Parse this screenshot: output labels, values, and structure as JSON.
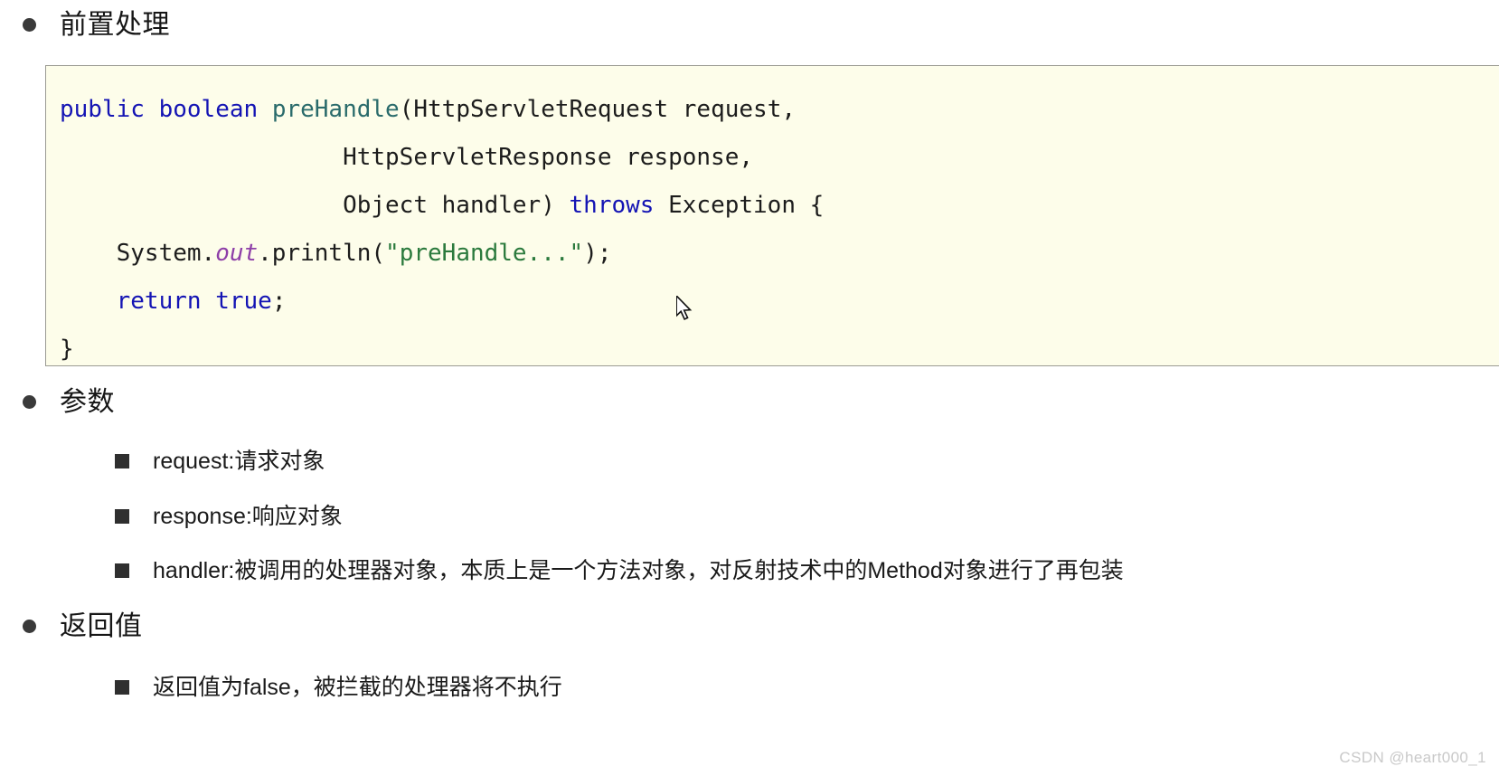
{
  "sections": [
    {
      "bullet": "disc",
      "label": "前置处理"
    },
    {
      "bullet": "disc",
      "label": "参数"
    },
    {
      "bullet": "disc",
      "label": "返回值"
    }
  ],
  "headings": {
    "pre_handle": "前置处理",
    "parameters": "参数",
    "return_value": "返回值"
  },
  "code": {
    "language": "java",
    "lines": [
      {
        "tokens": [
          {
            "text": "public",
            "style": "keyword"
          },
          {
            "text": " ",
            "style": "plain"
          },
          {
            "text": "boolean",
            "style": "keyword"
          },
          {
            "text": " ",
            "style": "plain"
          },
          {
            "text": "preHandle",
            "style": "function"
          },
          {
            "text": "(HttpServletRequest request,",
            "style": "plain"
          }
        ]
      },
      {
        "tokens": [
          {
            "text": "                    HttpServletResponse response,",
            "style": "plain"
          }
        ]
      },
      {
        "tokens": [
          {
            "text": "                    Object handler) ",
            "style": "plain"
          },
          {
            "text": "throws",
            "style": "keyword"
          },
          {
            "text": " Exception {",
            "style": "plain"
          }
        ]
      },
      {
        "tokens": [
          {
            "text": "    System.",
            "style": "plain"
          },
          {
            "text": "out",
            "style": "field"
          },
          {
            "text": ".println(",
            "style": "plain"
          },
          {
            "text": "\"preHandle...\"",
            "style": "string"
          },
          {
            "text": ");",
            "style": "plain"
          }
        ]
      },
      {
        "tokens": [
          {
            "text": "    ",
            "style": "plain"
          },
          {
            "text": "return",
            "style": "keyword"
          },
          {
            "text": " ",
            "style": "plain"
          },
          {
            "text": "true",
            "style": "keyword"
          },
          {
            "text": ";",
            "style": "plain"
          }
        ]
      },
      {
        "tokens": [
          {
            "text": "}",
            "style": "plain"
          }
        ]
      }
    ],
    "plain_text": "public boolean preHandle(HttpServletRequest request,\n                    HttpServletResponse response,\n                    Object handler) throws Exception {\n    System.out.println(\"preHandle...\");\n    return true;\n}"
  },
  "parameter_items": [
    {
      "name": "request",
      "separator": ":",
      "description": "请求对象",
      "full": "request:请求对象"
    },
    {
      "name": "response",
      "separator": ":",
      "description": "响应对象",
      "full": "response:响应对象"
    },
    {
      "name": "handler",
      "separator": ":",
      "description": "被调用的处理器对象，本质上是一个方法对象，对反射技术中的Method对象进行了再包装",
      "full": "handler:被调用的处理器对象，本质上是一个方法对象，对反射技术中的Method对象进行了再包装"
    }
  ],
  "return_items": [
    {
      "full": "返回值为false，被拦截的处理器将不执行",
      "value_literal": "false"
    }
  ],
  "watermark": "CSDN @heart000_1",
  "colors": {
    "page_background": "#ffffff",
    "code_background": "#fdfdea",
    "code_border": "#9b9b93",
    "keyword": "#1414b4",
    "function": "#2a6b6b",
    "string": "#2b7a3d",
    "field": "#8e3fa8",
    "text": "#1a1a1a",
    "bullet": "#3a3a3a",
    "watermark": "#c9c9c9"
  }
}
